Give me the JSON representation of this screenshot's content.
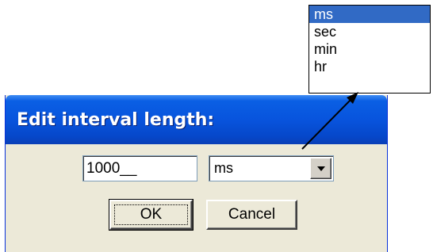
{
  "dialog": {
    "title": "Edit interval length:",
    "interval_value": "1000__",
    "unit_selected": "ms",
    "ok_label": "OK",
    "cancel_label": "Cancel"
  },
  "unit_dropdown": {
    "options": [
      "ms",
      "sec",
      "min",
      "hr"
    ],
    "highlighted": "ms"
  },
  "colors": {
    "title_bar": "#0854dd",
    "dialog_bg": "#ece9d8",
    "selection": "#316ac5"
  }
}
